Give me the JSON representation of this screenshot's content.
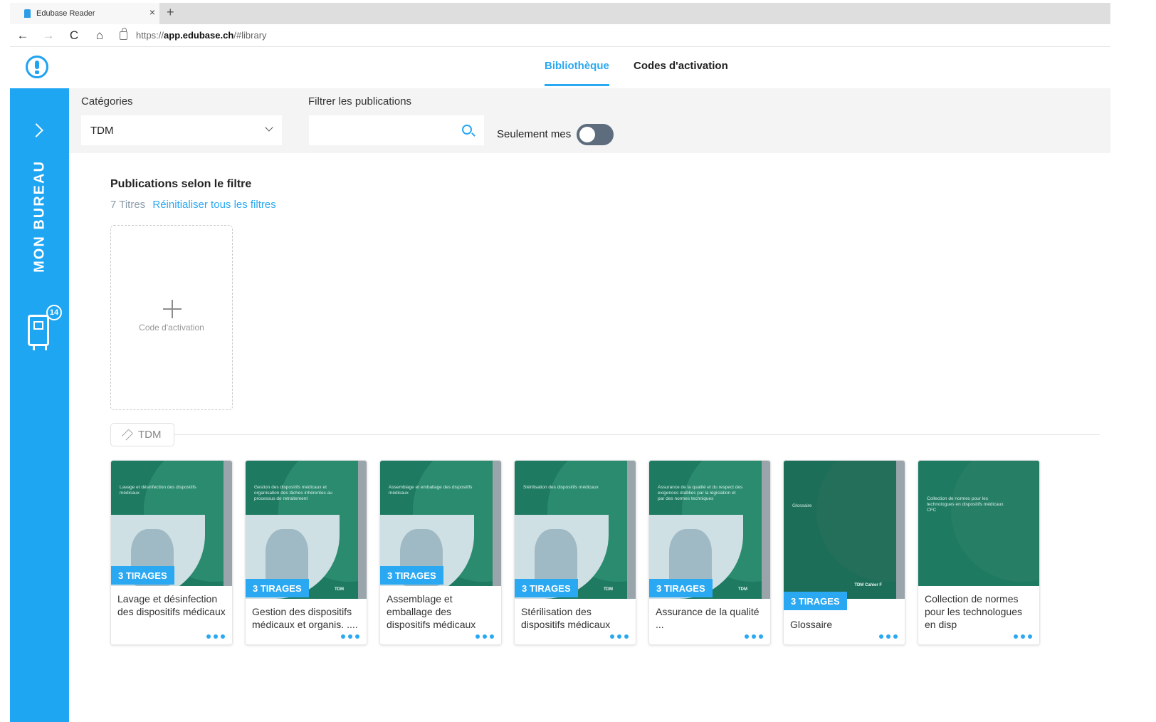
{
  "browser": {
    "tab_title": "Edubase Reader",
    "tab_close": "×",
    "new_tab": "+",
    "back": "←",
    "forward": "→",
    "reload": "C",
    "home": "⌂",
    "url_prefix": "https://",
    "url_host": "app.edubase.ch",
    "url_path": "/#library"
  },
  "header": {
    "tabs": [
      {
        "label": "Bibliothèque",
        "active": true
      },
      {
        "label": "Codes d'activation",
        "active": false
      }
    ]
  },
  "sidebar": {
    "label": "MON BUREAU",
    "badge_count": "14"
  },
  "filters": {
    "categories_label": "Catégories",
    "categories_value": "TDM",
    "filter_label": "Filtrer les publications",
    "filter_value": "",
    "toggle_label": "Seulement mes",
    "toggle_on": false
  },
  "content": {
    "title": "Publications selon le filtre",
    "count": "7 Titres",
    "reset_link": "Réinitialiser tous les filtres",
    "activation_label": "Code d'activation",
    "tag": "TDM",
    "colors": {
      "accent": "#2aa8f2",
      "sidebar": "#1ea6f3",
      "cover_green": "#1f7a62"
    }
  },
  "books": [
    {
      "cover_text": "Lavage et désinfection des dispositifs médicaux",
      "cover_small": "",
      "badge": "3 TIRAGES",
      "title": "Lavage et désinfection des dispositifs médicaux"
    },
    {
      "cover_text": "Gestion des dispositifs médicaux et organisation des tâches inhérentes au processus de retraitement",
      "cover_small": "TDM",
      "badge": "3 TIRAGES",
      "title": "Gestion des dispositifs médicaux et organis. ...."
    },
    {
      "cover_text": "Assemblage et emballage des dispositifs médicaux",
      "cover_small": "",
      "badge": "3 TIRAGES",
      "title": "Assemblage et emballage des dispositifs médicaux"
    },
    {
      "cover_text": "Stérilisation des dispositifs médicaux",
      "cover_small": "TDM",
      "badge": "3 TIRAGES",
      "title": "Stérilisation des dispositifs médicaux"
    },
    {
      "cover_text": "Assurance de la qualité et du respect des exigences établies par la législation et par des normes techniques",
      "cover_small": "TDM",
      "badge": "3 TIRAGES",
      "title": "Assurance de la qualité ..."
    },
    {
      "cover_text": "Glossaire",
      "cover_small": "TDM Cahier F",
      "badge": "3 TIRAGES",
      "title": "Glossaire"
    },
    {
      "cover_text": "Collection de normes pour les technologues en dispositifs médicaux CFC",
      "cover_small": "",
      "badge": "",
      "title": "Collection de normes pour les technologues en disp"
    }
  ]
}
